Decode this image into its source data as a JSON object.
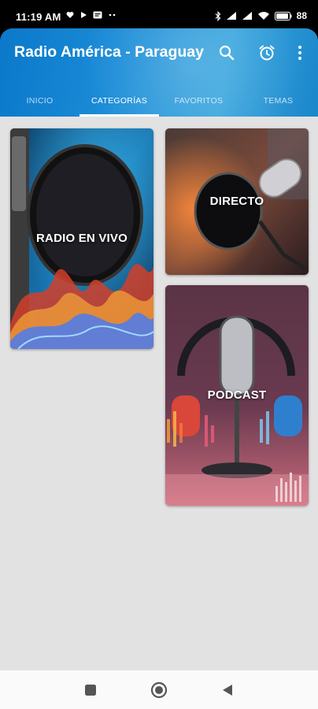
{
  "status_bar": {
    "time": "11:19 AM",
    "battery": "88",
    "icons_left": [
      "heart-notification-icon",
      "play-notification-icon",
      "message-notification-icon",
      "more-dots-icon"
    ],
    "icons_right": [
      "bluetooth-icon",
      "signal-icon",
      "signal-icon-2",
      "wifi-icon",
      "battery-icon"
    ]
  },
  "app_bar": {
    "title": "Radio América - Paraguay",
    "actions": [
      "search-icon",
      "alarm-icon",
      "more-vert-icon"
    ],
    "accent": "#1a8bd7"
  },
  "tabs": [
    {
      "label": "INICIO",
      "active": false
    },
    {
      "label": "CATEGORÍAS",
      "active": true
    },
    {
      "label": "FAVORITOS",
      "active": false
    },
    {
      "label": "TEMAS",
      "active": false
    }
  ],
  "categories": [
    {
      "label": "RADIO EN VIVO"
    },
    {
      "label": "DIRECTO"
    },
    {
      "label": "PODCAST"
    }
  ],
  "nav_bar": {
    "buttons": [
      "recents-square-icon",
      "home-circle-icon",
      "back-triangle-icon"
    ]
  }
}
